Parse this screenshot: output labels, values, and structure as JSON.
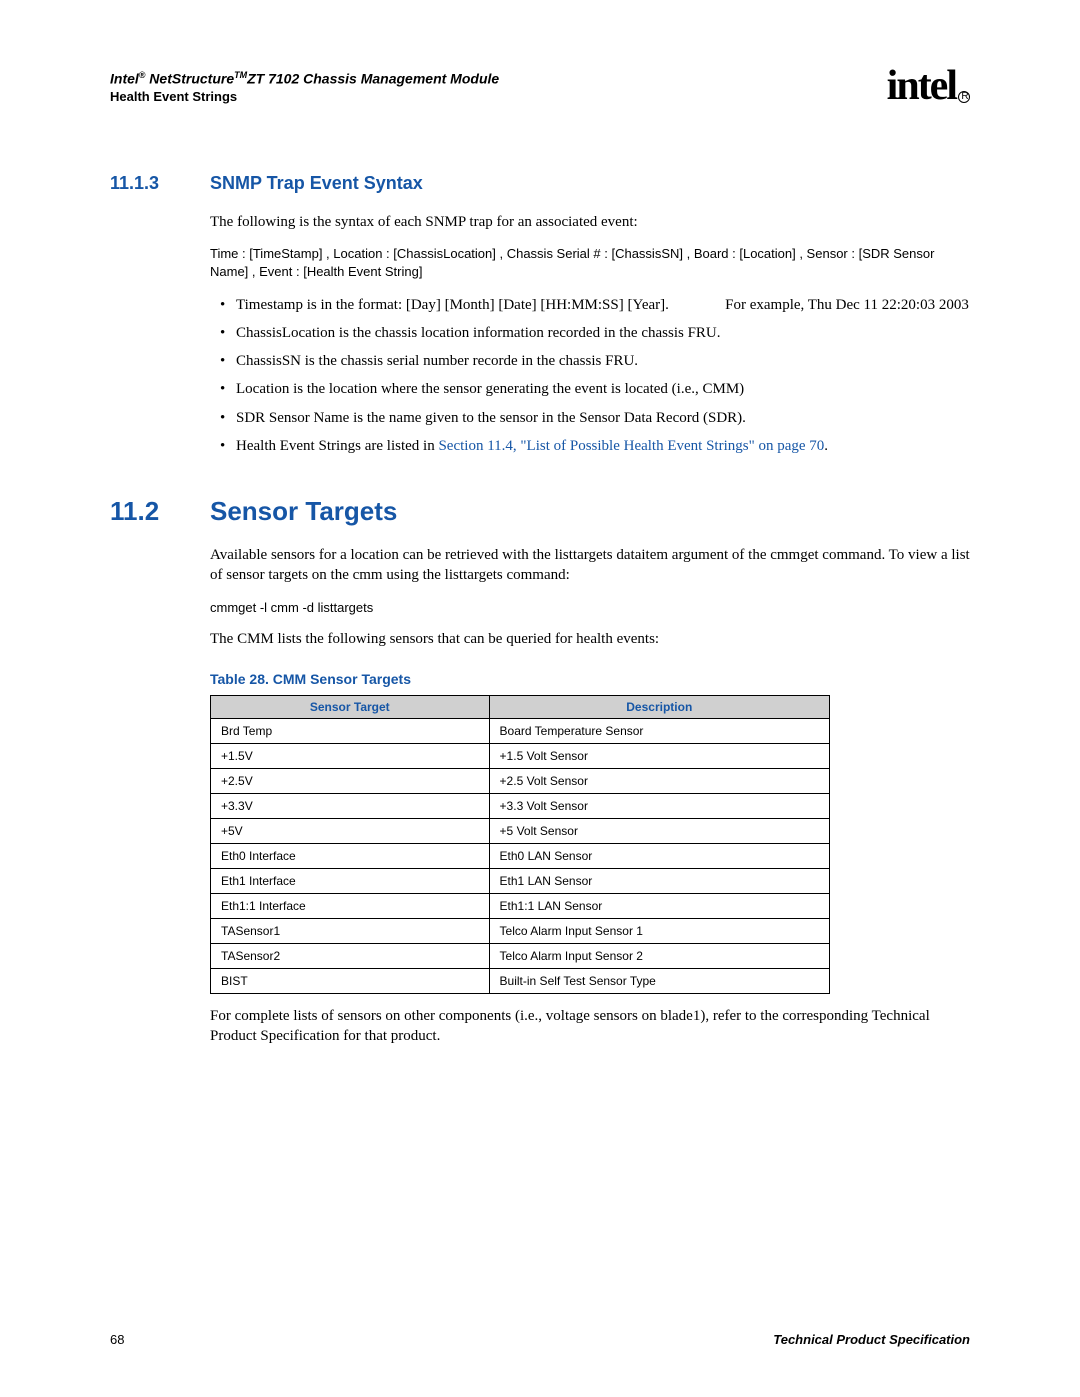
{
  "header": {
    "title_prefix": "Intel",
    "title_reg": "®",
    "title_mid": " NetStructure",
    "title_tm": "TM",
    "title_suffix": "ZT 7102 Chassis Management Module",
    "subtitle": "Health Event Strings",
    "logo_text": "intel",
    "logo_reg": "R"
  },
  "section_11_1_3": {
    "num": "11.1.3",
    "title": "SNMP Trap Event Syntax",
    "intro": "The following is the syntax of each SNMP trap for an associated event:",
    "syntax": "Time : [TimeStamp] , Location : [ChassisLocation] , Chassis Serial # : [ChassisSN] , Board : [Location] , Sensor : [SDR Sensor Name] , Event : [Health Event String]",
    "bullets": [
      {
        "text": "Timestamp is in the format: [Day] [Month] [Date] [HH:MM:SS] [Year].",
        "tail": "For example, Thu Dec 11 22:20:03 2003"
      },
      {
        "text": "ChassisLocation is the chassis location information recorded in the chassis FRU."
      },
      {
        "text": "ChassisSN is the chassis serial number recorde in the chassis FRU."
      },
      {
        "text": "Location is the location where the sensor generating the event is located (i.e., CMM)"
      },
      {
        "text": "SDR Sensor Name is the name given to the sensor in the Sensor Data Record (SDR)."
      },
      {
        "text_pre": "Health Event Strings are listed in ",
        "link": "Section 11.4, \"List of Possible Health Event Strings\" on page 70",
        "text_post": "."
      }
    ]
  },
  "section_11_2": {
    "num": "11.2",
    "title": "Sensor Targets",
    "para1": "Available sensors for a location can be retrieved with the listtargets dataitem argument of the cmmget command. To view a list of sensor targets on the cmm using the listtargets command:",
    "command": "cmmget -l cmm -d listtargets",
    "para2": "The CMM lists the following sensors that can be queried for health events:",
    "table_caption": "Table 28. CMM Sensor Targets",
    "table_headers": [
      "Sensor Target",
      "Description"
    ],
    "table_rows": [
      [
        "Brd Temp",
        "Board Temperature Sensor"
      ],
      [
        "+1.5V",
        "+1.5 Volt Sensor"
      ],
      [
        "+2.5V",
        "+2.5 Volt Sensor"
      ],
      [
        "+3.3V",
        "+3.3 Volt Sensor"
      ],
      [
        "+5V",
        "+5 Volt Sensor"
      ],
      [
        "Eth0 Interface",
        "Eth0 LAN Sensor"
      ],
      [
        "Eth1 Interface",
        "Eth1 LAN Sensor"
      ],
      [
        "Eth1:1 Interface",
        "Eth1:1 LAN Sensor"
      ],
      [
        "TASensor1",
        "Telco Alarm Input Sensor 1"
      ],
      [
        "TASensor2",
        "Telco Alarm Input Sensor 2"
      ],
      [
        "BIST",
        "Built-in Self Test Sensor Type"
      ]
    ],
    "para3": "For complete lists of sensors on other components (i.e., voltage sensors on blade1), refer to the corresponding Technical Product Specification for that product."
  },
  "footer": {
    "page": "68",
    "right": "Technical Product Specification"
  }
}
